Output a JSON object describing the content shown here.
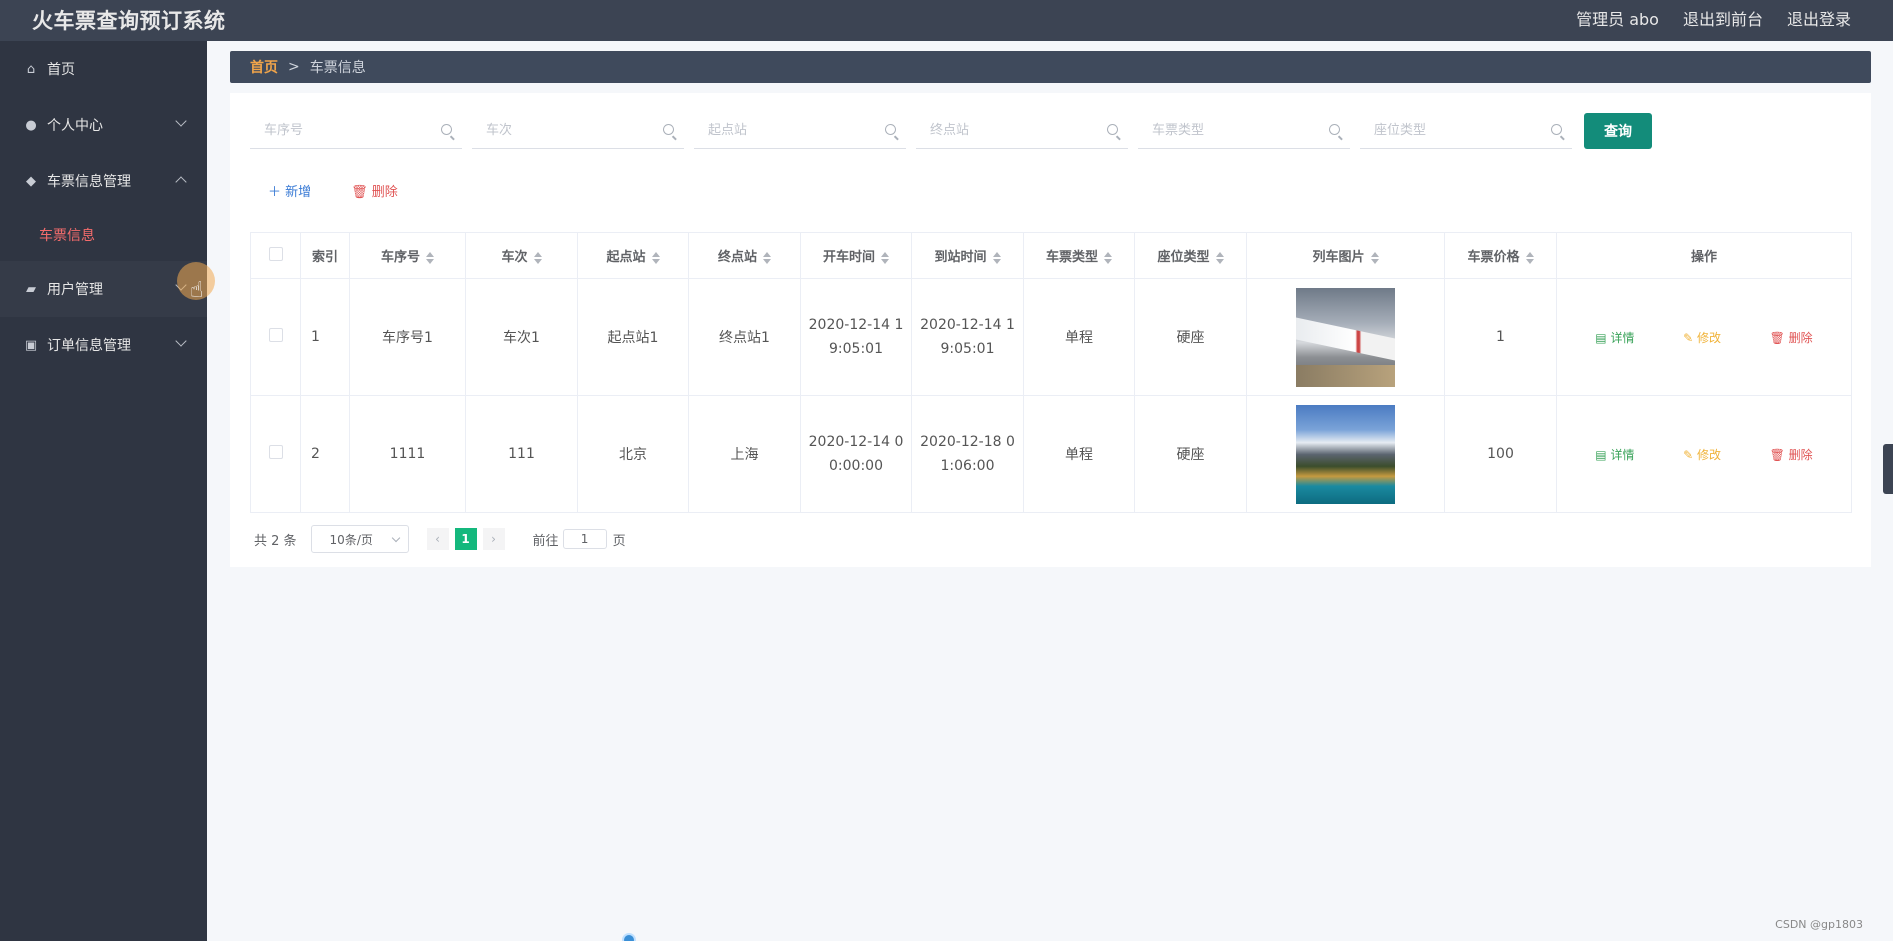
{
  "app": {
    "title": "火车票查询预订系统"
  },
  "topnav": {
    "admin": "管理员 abo",
    "to_front": "退出到前台",
    "logout": "退出登录"
  },
  "sidebar": {
    "items": [
      {
        "label": "首页",
        "icon": "home-icon"
      },
      {
        "label": "个人中心",
        "icon": "user-icon"
      },
      {
        "label": "车票信息管理",
        "icon": "location-icon"
      },
      {
        "label": "用户管理",
        "icon": "wallet-icon"
      },
      {
        "label": "订单信息管理",
        "icon": "briefcase-icon"
      }
    ],
    "subitem": "车票信息"
  },
  "breadcrumb": {
    "home": "首页",
    "sep": ">",
    "current": "车票信息"
  },
  "search": {
    "placeholders": [
      "车序号",
      "车次",
      "起点站",
      "终点站",
      "车票类型",
      "座位类型"
    ],
    "button": "查询"
  },
  "actions": {
    "add": "新增",
    "delete": "删除"
  },
  "table": {
    "headers": [
      "索引",
      "车序号",
      "车次",
      "起点站",
      "终点站",
      "开车时间",
      "到站时间",
      "车票类型",
      "座位类型",
      "列车图片",
      "车票价格",
      "操作"
    ],
    "rows": [
      {
        "index": "1",
        "serial": "车序号1",
        "train": "车次1",
        "from": "起点站1",
        "to": "终点站1",
        "depart_a": "2020-12-14 1",
        "depart_b": "9:05:01",
        "arrive_a": "2020-12-14 1",
        "arrive_b": "9:05:01",
        "ticket_type": "单程",
        "seat_type": "硬座",
        "price": "1"
      },
      {
        "index": "2",
        "serial": "1111",
        "train": "111",
        "from": "北京",
        "to": "上海",
        "depart_a": "2020-12-14 0",
        "depart_b": "0:00:00",
        "arrive_a": "2020-12-18 0",
        "arrive_b": "1:06:00",
        "ticket_type": "单程",
        "seat_type": "硬座",
        "price": "100"
      }
    ],
    "ops": {
      "detail": "详情",
      "edit": "修改",
      "delete": "删除"
    }
  },
  "pagination": {
    "total": "共 2 条",
    "page_size": "10条/页",
    "current_page": "1",
    "goto": "前往",
    "goto_value": "1",
    "page_unit": "页",
    "prev": "‹",
    "next": "›"
  },
  "watermark": "CSDN @gp1803"
}
